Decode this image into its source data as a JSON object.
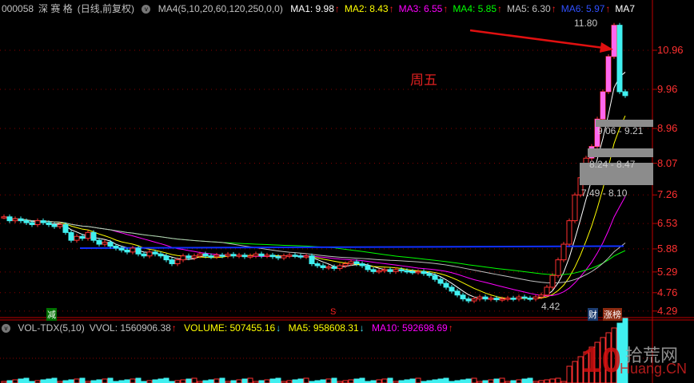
{
  "header": {
    "code": "000058",
    "name": "深 赛 格",
    "period": "(日线,前复权)",
    "indicator": "MA4(5,10,20,60,120,250,0,0)",
    "ma": [
      {
        "label": "MA1: 9.98",
        "color": "#ffffff"
      },
      {
        "label": "MA2: 8.43",
        "color": "#ffff00"
      },
      {
        "label": "MA3: 6.55",
        "color": "#ff00ff"
      },
      {
        "label": "MA4: 5.85",
        "color": "#00ff00"
      },
      {
        "label": "MA5: 6.30",
        "color": "#c0c0c0"
      },
      {
        "label": "MA6: 5.97",
        "color": "#3050ff"
      },
      {
        "label": "MA7",
        "color": "#ffffff"
      }
    ]
  },
  "price_axis": [
    "10.96",
    "9.96",
    "8.96",
    "8.07",
    "7.26",
    "6.53",
    "5.88",
    "5.29",
    "4.76",
    "4.29"
  ],
  "annotations": {
    "high": "11.80",
    "low": "4.42",
    "note": "周五",
    "box1": "9.06 - 9.21",
    "box2": "8.24 - 8.47",
    "box3": "7.49 - 8.10",
    "mark_reduce": "减",
    "mark_sell": "S",
    "mark_fin": "财",
    "mark_rank": "涨榜"
  },
  "volume_header": {
    "name": "VOL-TDX(5,10)",
    "vvol": "VVOL: 1560906.38",
    "volume": "VOLUME: 507455.16",
    "ma5": "MA5: 958608.31",
    "ma10": "MA10: 592698.69"
  },
  "watermark": {
    "num": "10",
    "cn": "拾荒网",
    "en": "Huang.CN"
  },
  "colors": {
    "up": "#ff3030",
    "down": "#40f0f0",
    "axis": "#c00000"
  },
  "closes": [
    6.7,
    6.6,
    6.65,
    6.6,
    6.55,
    6.5,
    6.6,
    6.55,
    6.5,
    6.45,
    6.5,
    6.3,
    6.1,
    6.2,
    6.15,
    6.3,
    6.1,
    6.0,
    6.05,
    5.95,
    5.9,
    5.85,
    5.8,
    5.9,
    5.75,
    5.7,
    5.8,
    5.75,
    5.7,
    5.6,
    5.5,
    5.6,
    5.7,
    5.65,
    5.7,
    5.75,
    5.7,
    5.68,
    5.72,
    5.7,
    5.74,
    5.7,
    5.72,
    5.68,
    5.7,
    5.75,
    5.7,
    5.72,
    5.68,
    5.65,
    5.7,
    5.72,
    5.7,
    5.68,
    5.7,
    5.5,
    5.45,
    5.4,
    5.42,
    5.38,
    5.45,
    5.5,
    5.55,
    5.5,
    5.45,
    5.35,
    5.3,
    5.32,
    5.35,
    5.3,
    5.35,
    5.32,
    5.3,
    5.28,
    5.3,
    5.25,
    5.2,
    5.1,
    5.0,
    4.9,
    4.8,
    4.7,
    4.6,
    4.55,
    4.6,
    4.65,
    4.6,
    4.62,
    4.58,
    4.6,
    4.62,
    4.6,
    4.65,
    4.62,
    4.6,
    4.65,
    4.7,
    4.9,
    5.2,
    5.6,
    6.0,
    6.6,
    7.26,
    7.7,
    8.2,
    8.5,
    9.2,
    9.9,
    10.8,
    11.6,
    9.9,
    9.8
  ]
}
